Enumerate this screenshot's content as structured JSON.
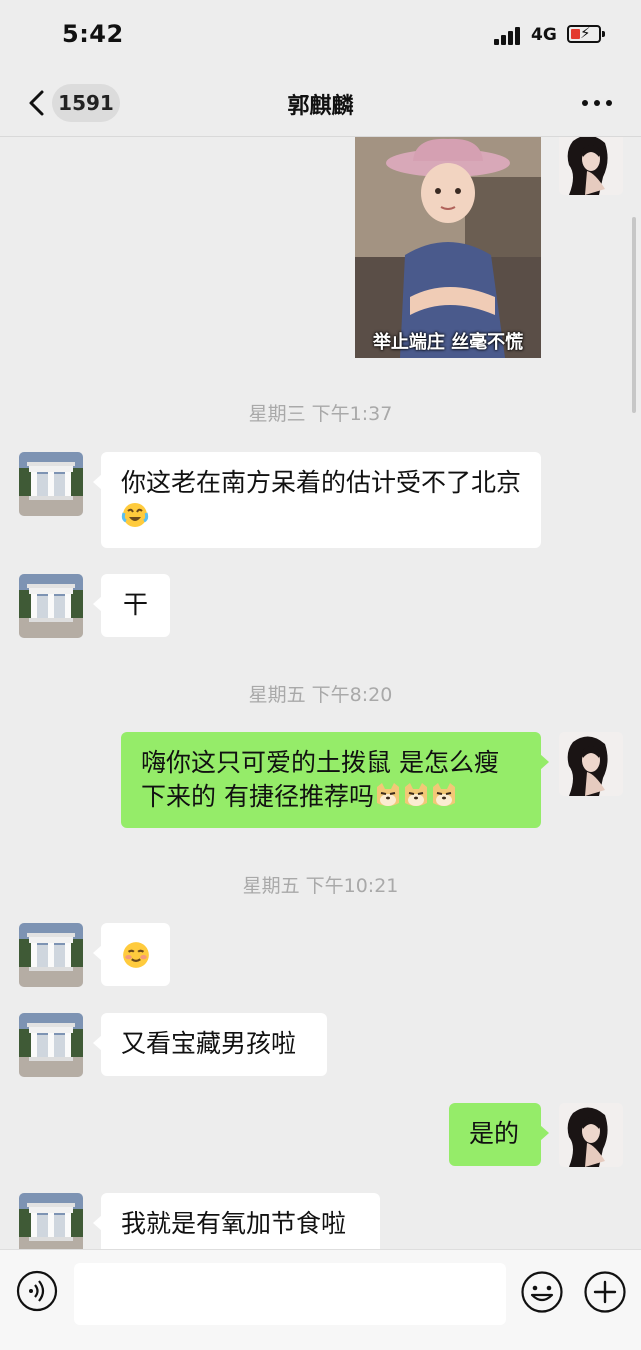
{
  "status": {
    "time": "5:42",
    "network": "4G"
  },
  "nav": {
    "unread": "1591",
    "title": "郭麒麟"
  },
  "meme": {
    "caption": "举止端庄  丝毫不慌"
  },
  "timestamps": [
    "星期三 下午1:37",
    "星期五 下午8:20",
    "星期五 下午10:21"
  ],
  "messages": [
    {
      "side": "left",
      "text": "你这老在南方呆着的估计受不了北京",
      "emoji": "laughing-crying-emoji"
    },
    {
      "side": "left",
      "text": "干"
    },
    {
      "side": "right",
      "text": "嗨你这只可爱的土拨鼠 是怎么瘦下来的 有捷径推荐吗",
      "emoji": "doge-emoji x3"
    },
    {
      "side": "left",
      "text": "",
      "emoji": "blushing-smile-emoji"
    },
    {
      "side": "left",
      "text": "又看宝藏男孩啦"
    },
    {
      "side": "right",
      "text": "是的"
    },
    {
      "side": "left",
      "text": "我就是有氧加节食啦"
    }
  ],
  "colors": {
    "background": "#ededed",
    "my_bubble": "#95ec69",
    "their_bubble": "#ffffff",
    "timestamp": "#a9a9a9"
  }
}
